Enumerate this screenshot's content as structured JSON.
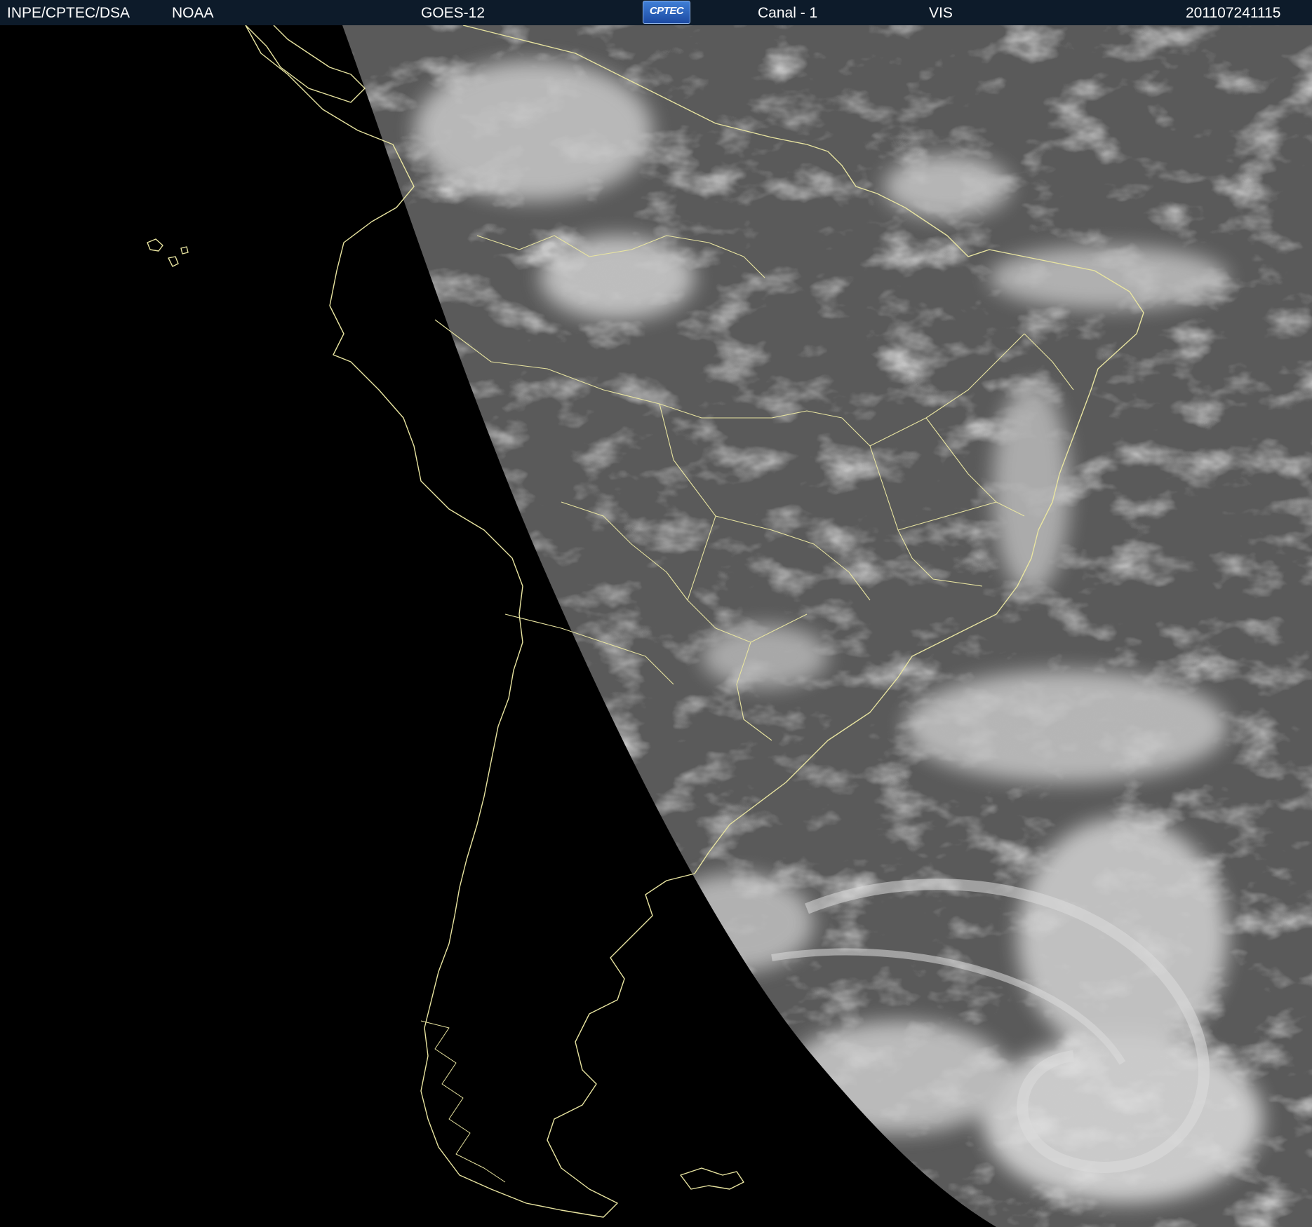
{
  "header": {
    "agency": "INPE/CPTEC/DSA",
    "provider": "NOAA",
    "satellite": "GOES-12",
    "logo_text": "CPTEC",
    "channel": "Canal - 1",
    "band": "VIS",
    "timestamp": "201107241115"
  },
  "map": {
    "coastline_color": "#e8e4a0",
    "space_color": "#000000",
    "earth_tone": "#5a5a5a",
    "cloud_tone": "#e6e6e6"
  }
}
